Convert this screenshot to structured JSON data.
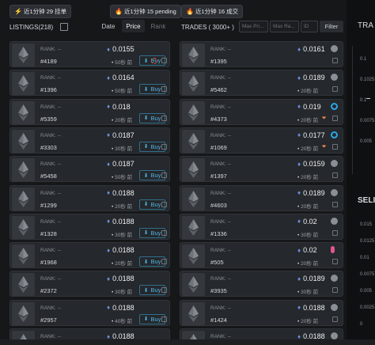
{
  "pills": [
    {
      "icon": "lightning-icon",
      "text": "近1分钟 29 挂单"
    },
    {
      "icon": "fire-icon",
      "text": "近1分钟 15 pending"
    },
    {
      "icon": "fire-icon",
      "text": "近1分钟 16 成交"
    }
  ],
  "listings": {
    "title": "LISTINGS(218)",
    "sort": [
      "Date",
      "Price",
      "Rank"
    ],
    "rank_label": "RANK:",
    "rank_value": "--",
    "buy_label": "Buy",
    "items": [
      {
        "num": "#4189",
        "price": "0.0155",
        "ago": "50秒 前"
      },
      {
        "num": "#1396",
        "price": "0.0164",
        "ago": "50秒 前"
      },
      {
        "num": "#5359",
        "price": "0.018",
        "ago": "20秒 前"
      },
      {
        "num": "#3303",
        "price": "0.0187",
        "ago": "30秒 前"
      },
      {
        "num": "#5458",
        "price": "0.0187",
        "ago": "50秒 前"
      },
      {
        "num": "#1299",
        "price": "0.0188",
        "ago": "20秒 前"
      },
      {
        "num": "#1328",
        "price": "0.0188",
        "ago": "30秒 前"
      },
      {
        "num": "#1968",
        "price": "0.0188",
        "ago": "20秒 前"
      },
      {
        "num": "#2372",
        "price": "0.0188",
        "ago": "30秒 前"
      },
      {
        "num": "#2957",
        "price": "0.0188",
        "ago": "40秒 前"
      },
      {
        "num": "",
        "price": "0.0188",
        "ago": ""
      }
    ]
  },
  "trades": {
    "title": "TRADES ( 3000+ )",
    "max_price_placeholder": "Max Pri...",
    "max_rank_placeholder": "Max Ra...",
    "id_placeholder": "ID",
    "filter_label": "Filter",
    "rank_label": "RANK:",
    "rank_value": "--",
    "items": [
      {
        "num": "#1395",
        "price": "0.0161",
        "ago": "",
        "marker": "gray"
      },
      {
        "num": "#5462",
        "price": "0.0189",
        "ago": "20秒 前",
        "marker": "gray"
      },
      {
        "num": "#4373",
        "price": "0.019",
        "ago": "20秒 前",
        "marker": "blue"
      },
      {
        "num": "#1069",
        "price": "0.0177",
        "ago": "20秒 前",
        "marker": "blue"
      },
      {
        "num": "#1397",
        "price": "0.0159",
        "ago": "20秒 前",
        "marker": "gray"
      },
      {
        "num": "#4603",
        "price": "0.0189",
        "ago": "20秒 前",
        "marker": "gray"
      },
      {
        "num": "#1336",
        "price": "0.02",
        "ago": "30秒 前",
        "marker": "gray"
      },
      {
        "num": "#505",
        "price": "0.02",
        "ago": "20秒 前",
        "marker": "pink"
      },
      {
        "num": "#3935",
        "price": "0.0189",
        "ago": "30秒 前",
        "marker": "gray"
      },
      {
        "num": "#1424",
        "price": "0.0188",
        "ago": "20秒 前",
        "marker": "gray"
      },
      {
        "num": "",
        "price": "0.0188",
        "ago": "",
        "marker": "gray"
      }
    ]
  },
  "right_panel": {
    "title": "TRA",
    "ticks_top": [
      "0.1",
      "0.1025",
      "0.1",
      "0.0075",
      "0.005"
    ],
    "section": "SELI",
    "ticks_bottom": [
      "0.015",
      "0.0125",
      "0.01",
      "0.0075",
      "0.005",
      "0.0025",
      "0"
    ]
  }
}
